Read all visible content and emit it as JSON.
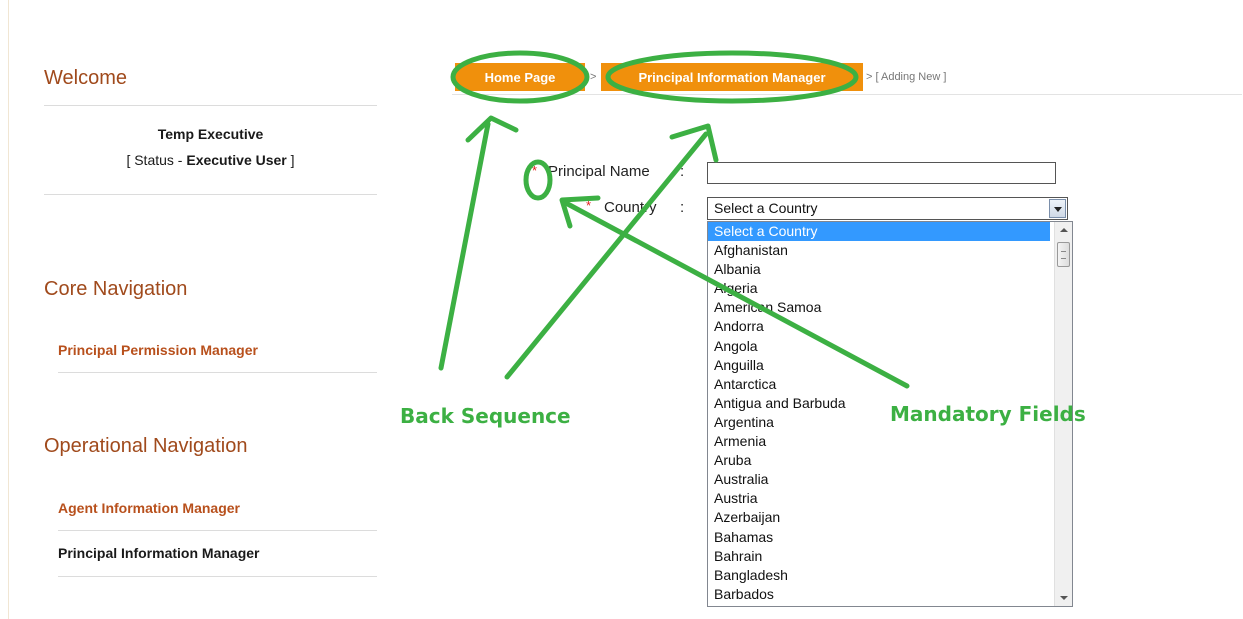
{
  "sidebar": {
    "welcome_heading": "Welcome",
    "user_name": "Temp Executive",
    "status_prefix": "[ Status - ",
    "status_value": "Executive User",
    "status_suffix": " ]",
    "core_heading": "Core Navigation",
    "core_items": [
      "Principal Permission Manager"
    ],
    "operational_heading": "Operational Navigation",
    "operational_items": [
      "Agent Information Manager",
      "Principal Information Manager"
    ]
  },
  "breadcrumb": {
    "home_label": "Home Page",
    "separator": ">",
    "section_label": "Principal Information Manager",
    "tail": "> [ Adding New ]"
  },
  "form": {
    "required_marker": "*",
    "colon": ":",
    "principal_name_label": "Principal Name",
    "principal_name_value": "",
    "country_label": "Country",
    "country_selected": "Select a Country",
    "country_options": [
      "Select a Country",
      "Afghanistan",
      "Albania",
      "Algeria",
      "American Samoa",
      "Andorra",
      "Angola",
      "Anguilla",
      "Antarctica",
      "Antigua and Barbuda",
      "Argentina",
      "Armenia",
      "Aruba",
      "Australia",
      "Austria",
      "Azerbaijan",
      "Bahamas",
      "Bahrain",
      "Bangladesh",
      "Barbados"
    ]
  },
  "annotations": {
    "back_sequence": "Back Sequence",
    "mandatory_fields": "Mandatory Fields",
    "color": "#3cb043"
  },
  "colors": {
    "accent_orange": "#f0900c",
    "nav_link": "#b8501c",
    "heading": "#a04a1c",
    "selection": "#3399ff"
  }
}
